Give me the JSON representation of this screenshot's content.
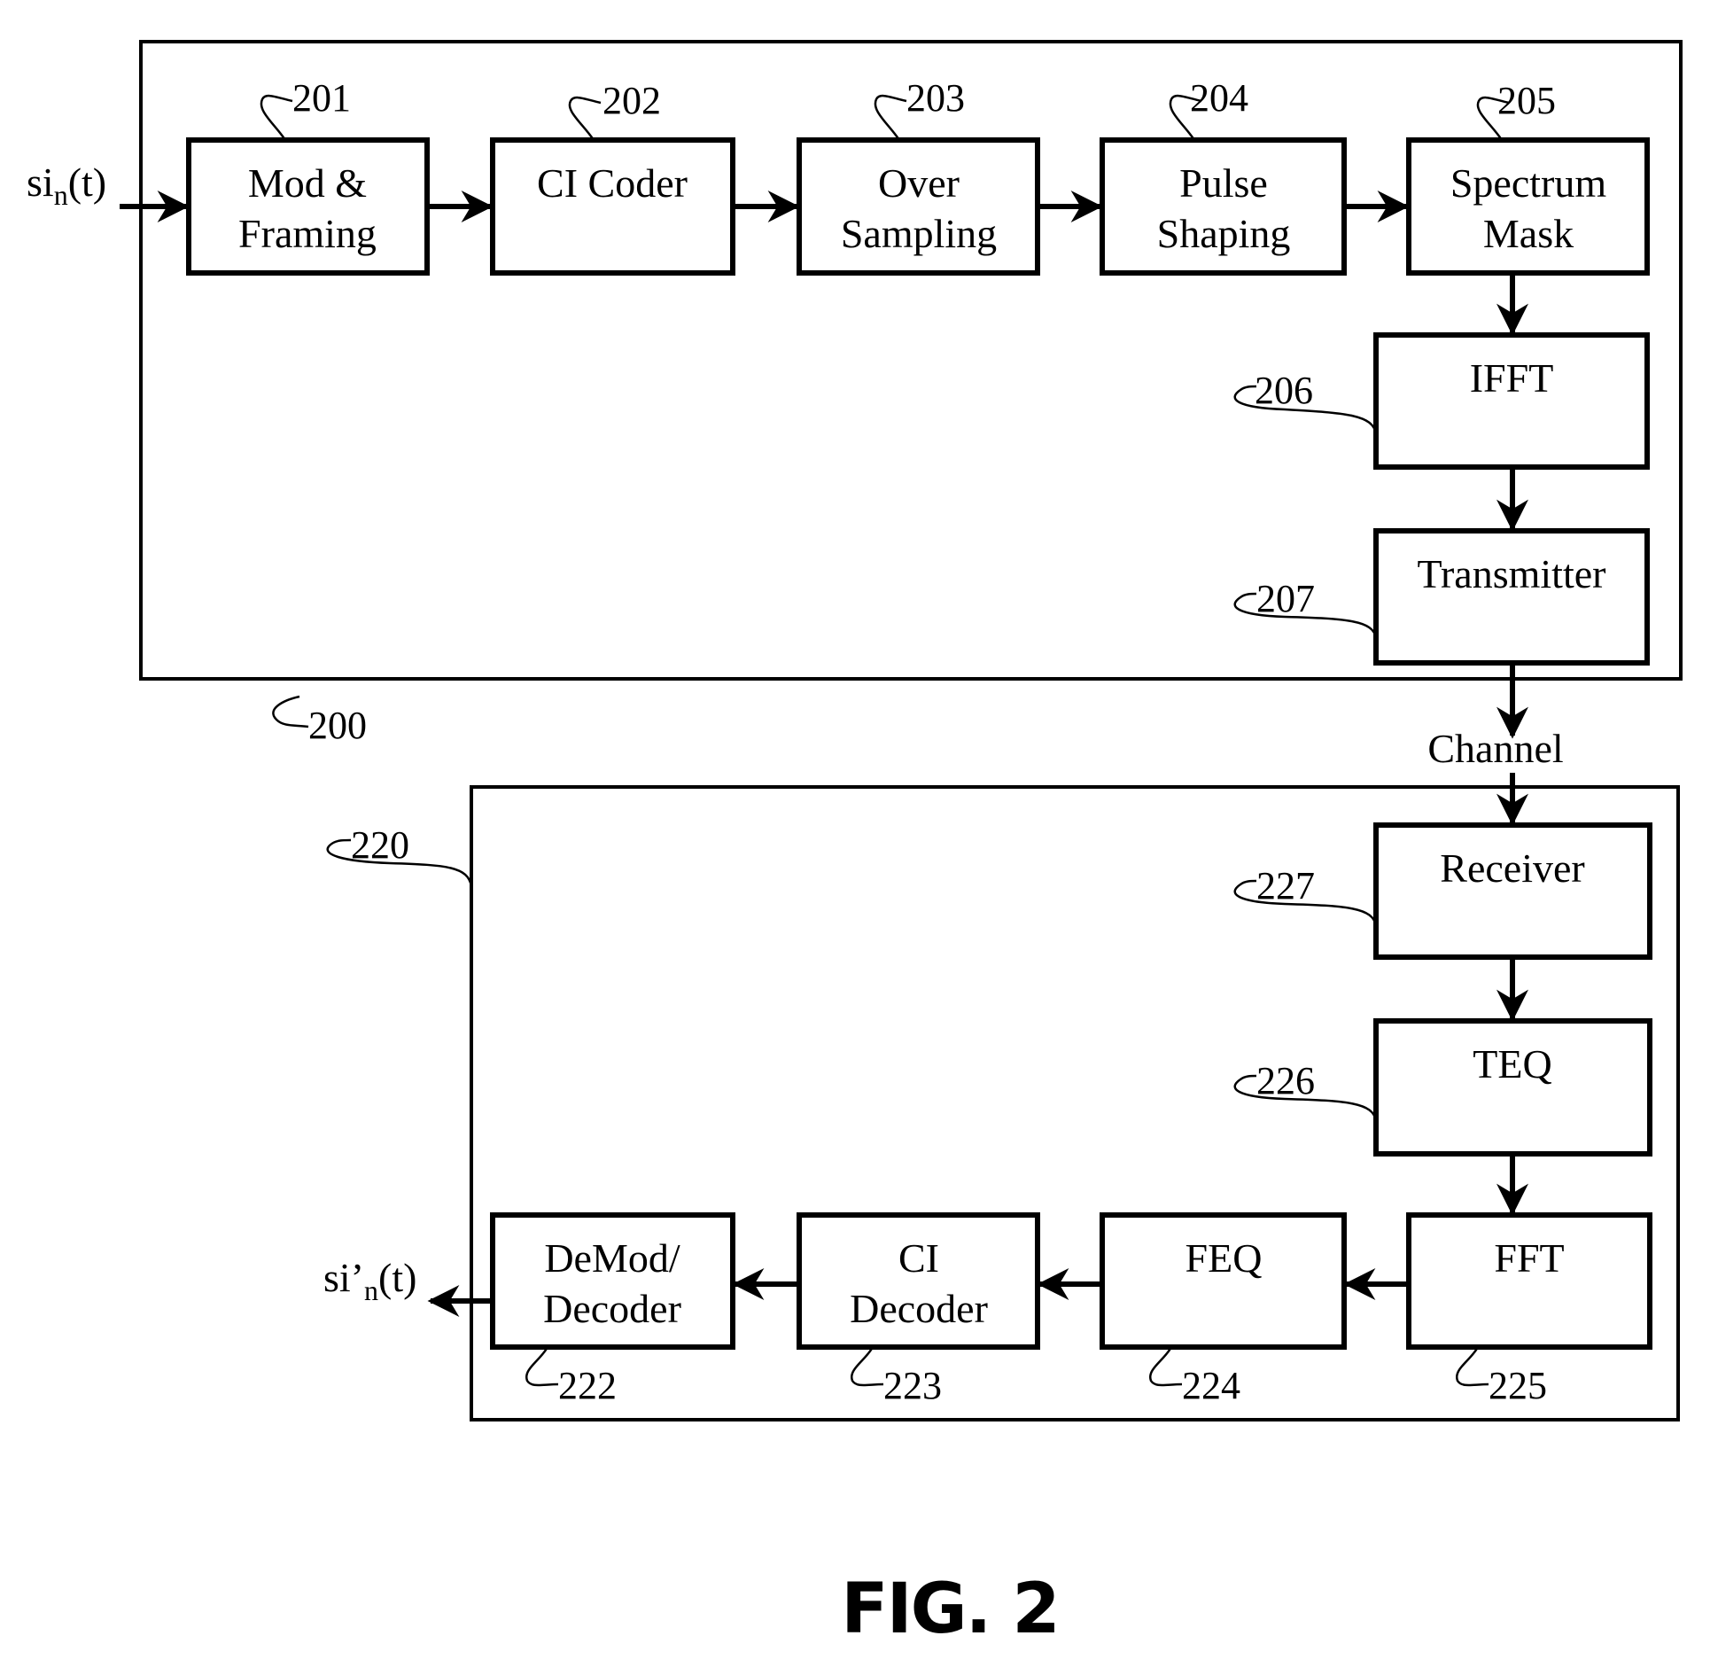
{
  "figure": {
    "caption": "FIG. 2"
  },
  "io": {
    "input_signal": {
      "base": "si",
      "sub": "n",
      "tail": "(t)"
    },
    "output_signal": {
      "base": "si’",
      "sub": "n",
      "tail": "(t)"
    },
    "channel_label": "Channel"
  },
  "transmitter": {
    "ref": "200",
    "blocks": [
      {
        "ref": "201",
        "lines": [
          "Mod &",
          "Framing"
        ]
      },
      {
        "ref": "202",
        "lines": [
          "CI Coder",
          ""
        ]
      },
      {
        "ref": "203",
        "lines": [
          "Over",
          "Sampling"
        ]
      },
      {
        "ref": "204",
        "lines": [
          "Pulse",
          "Shaping"
        ]
      },
      {
        "ref": "205",
        "lines": [
          "Spectrum",
          "Mask"
        ]
      },
      {
        "ref": "206",
        "lines": [
          "IFFT"
        ]
      },
      {
        "ref": "207",
        "lines": [
          "Transmitter"
        ]
      }
    ]
  },
  "receiver": {
    "ref": "220",
    "blocks": [
      {
        "ref": "227",
        "lines": [
          "Receiver"
        ]
      },
      {
        "ref": "226",
        "lines": [
          "TEQ"
        ]
      },
      {
        "ref": "225",
        "lines": [
          "FFT"
        ]
      },
      {
        "ref": "224",
        "lines": [
          "FEQ"
        ]
      },
      {
        "ref": "223",
        "lines": [
          "CI",
          "Decoder"
        ]
      },
      {
        "ref": "222",
        "lines": [
          "DeMod/",
          "Decoder"
        ]
      }
    ]
  }
}
